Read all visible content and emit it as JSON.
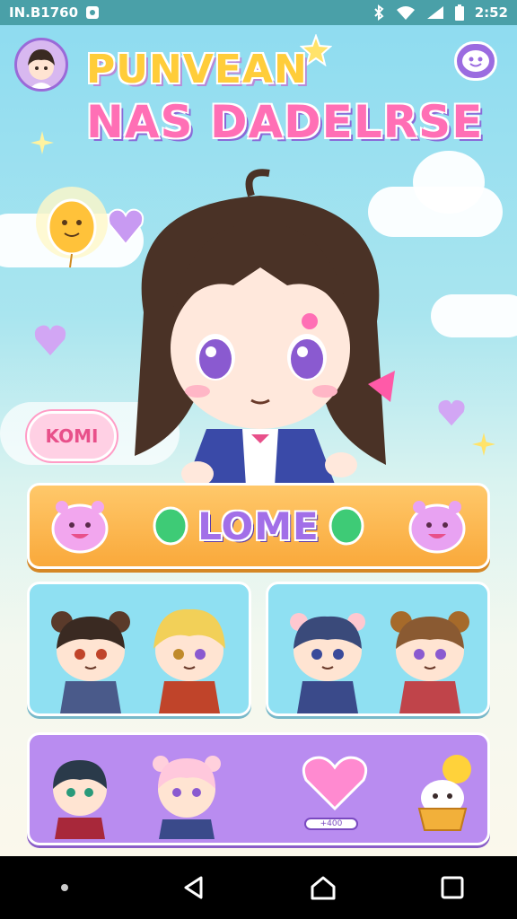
{
  "status_bar": {
    "carrier_text": "IN.B1760",
    "time": "2:52",
    "icons": [
      "notification-icon",
      "bluetooth-icon",
      "wifi-icon",
      "signal-icon",
      "battery-icon"
    ]
  },
  "header": {
    "title_line1": "PUNVEAN",
    "title_line2": "NAS DADELRSE"
  },
  "hero": {
    "speech_bubble": "KOMI"
  },
  "main_button": {
    "label": "LOME"
  },
  "cards": [
    {
      "name": "duo-card-left",
      "style": "blue"
    },
    {
      "name": "duo-card-right",
      "style": "blue"
    },
    {
      "name": "shop-card",
      "style": "purple",
      "bar_label": "+400"
    }
  ],
  "colors": {
    "status_bar": "#4aa0a8",
    "title1": "#ffcd3a",
    "title2": "#ff6fb5",
    "main_button": "#f9a93b",
    "card_blue": "#8fe0f2",
    "card_purple": "#b98cf0"
  }
}
